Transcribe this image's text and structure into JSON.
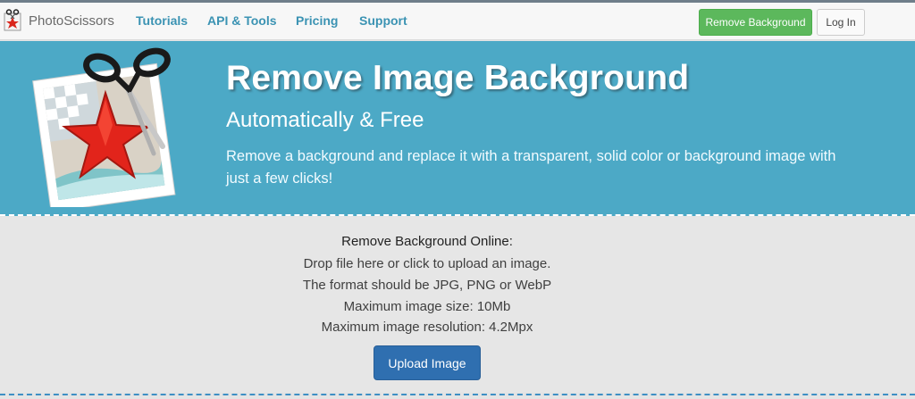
{
  "nav": {
    "brand": "PhotoScissors",
    "links": [
      "Tutorials",
      "API & Tools",
      "Pricing",
      "Support"
    ],
    "remove_background_button": "Remove Background",
    "login_button": "Log In"
  },
  "hero": {
    "title": "Remove Image Background",
    "subtitle": "Automatically & Free",
    "description": "Remove a background and replace it with a transparent, solid color or background image with just a few clicks!"
  },
  "upload": {
    "heading": "Remove Background Online:",
    "lines": [
      "Drop file here or click to upload an image.",
      "The format should be JPG, PNG or WebP",
      "Maximum image size: 10Mb",
      "Maximum image resolution: 4.2Mpx"
    ],
    "button": "Upload Image"
  },
  "colors": {
    "hero_bg": "#4ca9c6",
    "nav_link": "#3b93b3",
    "remove_button": "#5cb85c",
    "upload_button": "#2f6fb0"
  },
  "icons": [
    "photoscissors-logo-icon",
    "scissors-starfish-illustration"
  ]
}
